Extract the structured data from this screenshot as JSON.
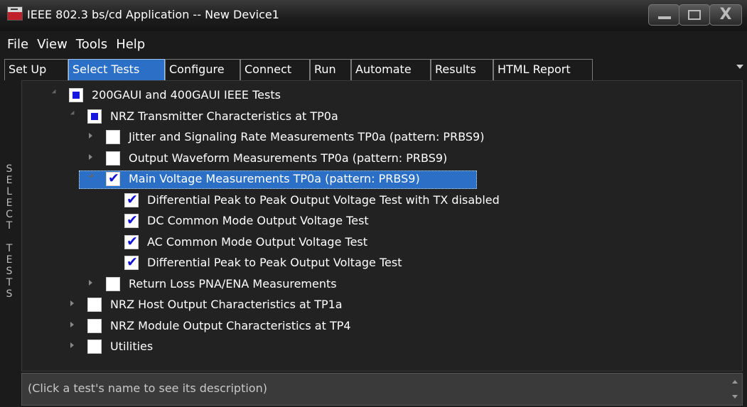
{
  "window": {
    "title": "IEEE 802.3 bs/cd Application -- New Device1",
    "close_glyph": "X"
  },
  "menu": [
    "File",
    "View",
    "Tools",
    "Help"
  ],
  "tabs": [
    "Set Up",
    "Select Tests",
    "Configure",
    "Connect",
    "Run",
    "Automate",
    "Results",
    "HTML Report"
  ],
  "active_tab": "Select Tests",
  "side_label": "SELECT TESTS",
  "tree": [
    {
      "label": "200GAUI and 400GAUI IEEE Tests",
      "state": "partial",
      "expand": "open"
    },
    {
      "label": "NRZ Transmitter Characteristics at TP0a",
      "state": "partial",
      "expand": "open"
    },
    {
      "label": "Jitter and Signaling Rate Measurements TP0a (pattern: PRBS9)",
      "state": "unchecked",
      "expand": "closed"
    },
    {
      "label": "Output Waveform Measurements TP0a (pattern: PRBS9)",
      "state": "unchecked",
      "expand": "closed"
    },
    {
      "label": "Main Voltage Measurements TP0a (pattern: PRBS9)",
      "state": "checked",
      "expand": "open",
      "selected": true
    },
    {
      "label": "Differential Peak to Peak Output Voltage Test with TX disabled",
      "state": "checked",
      "expand": "none"
    },
    {
      "label": "DC Common Mode Output Voltage Test",
      "state": "checked",
      "expand": "none"
    },
    {
      "label": "AC Common Mode Output Voltage Test",
      "state": "checked",
      "expand": "none"
    },
    {
      "label": "Differential Peak to Peak Output Voltage Test",
      "state": "checked",
      "expand": "none"
    },
    {
      "label": "Return Loss PNA/ENA Measurements",
      "state": "unchecked",
      "expand": "closed"
    },
    {
      "label": "NRZ Host Output Characteristics at TP1a",
      "state": "unchecked",
      "expand": "closed"
    },
    {
      "label": "NRZ Module Output Characteristics at TP4",
      "state": "unchecked",
      "expand": "closed"
    },
    {
      "label": "Utilities",
      "state": "unchecked",
      "expand": "closed"
    }
  ],
  "description": "(Click a test's name to see its description)",
  "colors": {
    "accent": "#2b6fc6",
    "check": "#1212d8",
    "background": "#1b1b1b"
  }
}
